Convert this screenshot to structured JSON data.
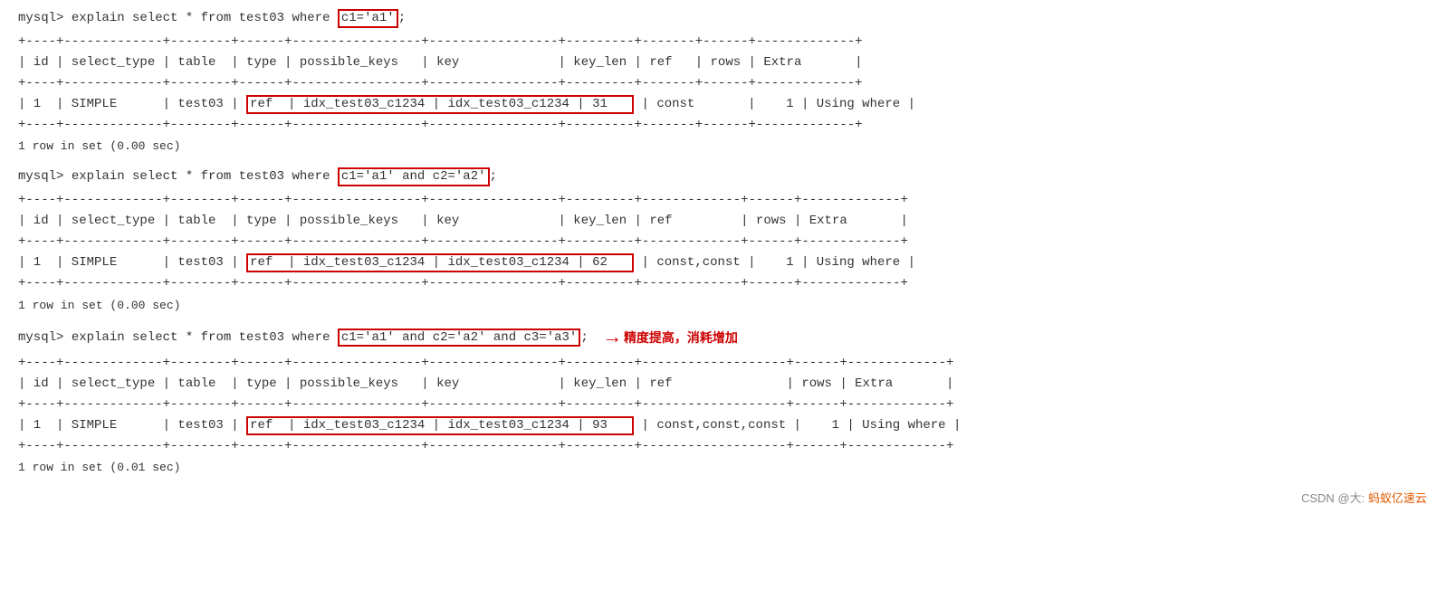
{
  "queries": [
    {
      "id": "q1",
      "prompt": "mysql>",
      "sql_before": " explain select * from test03 where ",
      "sql_highlight": "c1='a1'",
      "sql_after": ";",
      "annotation": null,
      "table": {
        "separator": "+----+-------------+--------+------+-----------------+-----------------+---------+-------+------+-------------+",
        "header": "| id | select_type | table  | type | possible_keys   | key             | key_len | ref   | rows | Extra       |",
        "data_before": "| 1  | SIMPLE      | test03 |",
        "data_highlight": " ref  | idx_test03_c1234 | idx_test03_c1234 | 31    ",
        "data_after": "| const       | 1    | Using where |"
      },
      "rowcount": "1 row in set (0.00 sec)"
    },
    {
      "id": "q2",
      "prompt": "mysql>",
      "sql_before": " explain select * from test03 where ",
      "sql_highlight": "c1='a1' and c2='a2'",
      "sql_after": ";",
      "annotation": null,
      "table": {
        "separator": "+----+-------------+--------+------+-----------------+-----------------+---------+------------+------+-------------+",
        "header": "| id | select_type | table  | type | possible_keys   | key             | key_len | ref        | rows | Extra       |",
        "data_before": "| 1  | SIMPLE      | test03 |",
        "data_highlight": " ref  | idx_test03_c1234 | idx_test03_c1234 | 62    ",
        "data_after": "| const,const | 1    | Using where |"
      },
      "rowcount": "1 row in set (0.00 sec)"
    },
    {
      "id": "q3",
      "prompt": "mysql>",
      "sql_before": " explain select * from test03 where ",
      "sql_highlight": "c1='a1' and c2='a2' and c3='a3'",
      "sql_after": ";",
      "annotation": {
        "arrow": "→",
        "text": "精度提高，消耗增加"
      },
      "table": {
        "separator": "+----+-------------+--------+------+-----------------+-----------------+---------+-------------------+------+-------------+",
        "header": "| id | select_type | table  | type | possible_keys   | key             | key_len | ref               | rows | Extra       |",
        "data_before": "| 1  | SIMPLE      | test03 |",
        "data_highlight": " ref  | idx_test03_c1234 | idx_test03_c1234 | 93    ",
        "data_after": "| const,const,const | 1    | Using where |"
      },
      "rowcount": "1 row in set (0.01 sec)"
    }
  ],
  "footer": {
    "csdn_label": "CSDN @大:",
    "brand_label": "蚂蚁亿速云"
  }
}
